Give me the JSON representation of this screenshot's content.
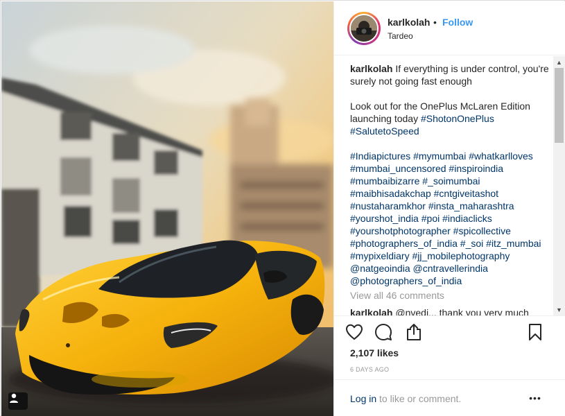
{
  "post": {
    "photo_alt": "",
    "username": "karlkolah",
    "follow_label": "Follow",
    "separator": "•",
    "location": "Tardeo"
  },
  "caption": {
    "username": "karlkolah",
    "line1_text": "If everything is under control, you're surely not going fast enough",
    "line2_text": "Look out for the OnePlus McLaren Edition launching today ",
    "line2_tags": [
      "#ShotonOnePlus",
      "#SalutetoSpeed"
    ],
    "hashtags": [
      "#Indiapictures",
      "#mymumbai",
      "#whatkarlloves",
      "#mumbai_uncensored",
      "#inspiroindia",
      "#mumbaibizarre",
      "#_soimumbai",
      "#maibhisadakchap",
      "#cntgiveitashot",
      "#nustaharamkhor",
      "#insta_maharashtra",
      "#yourshot_india",
      "#poi",
      "#indiaclicks",
      "#yourshotphotographer",
      "#spicollective",
      "#photographers_of_india",
      "#_soi",
      "#itz_mumbai",
      "#mypixeldiary",
      "#jj_mobilephotography",
      "@natgeoindia",
      "@cntravellerindia",
      "@photographers_of_india"
    ]
  },
  "comments": {
    "view_all_label": "View all 46 comments",
    "partial_comment_user": "karlkolah",
    "partial_comment_text": "@nvedi... thank you very much"
  },
  "actions": {
    "like_icon": "heart-icon",
    "comment_icon": "comment-icon",
    "share_icon": "share-icon",
    "save_icon": "bookmark-icon",
    "likes_label": "2,107 likes",
    "time_label": "6 DAYS AGO",
    "login_link": "Log in",
    "login_suffix": " to like or comment.",
    "more_label": "•••"
  },
  "colors": {
    "link_blue": "#3897f0",
    "tag_navy": "#003569",
    "muted": "#999999",
    "text": "#262626"
  }
}
